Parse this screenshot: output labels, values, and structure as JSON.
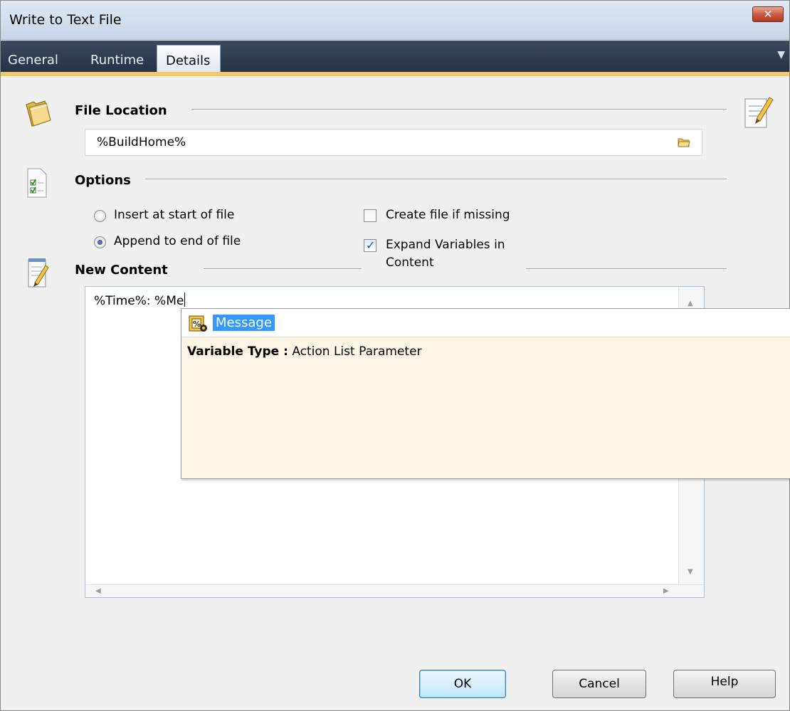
{
  "window": {
    "title": "Write to Text File"
  },
  "titlebar": {
    "close_glyph": "✕"
  },
  "tabs": [
    {
      "label": "General",
      "selected": false
    },
    {
      "label": "Runtime",
      "selected": false
    },
    {
      "label": "Details",
      "selected": true
    }
  ],
  "tab_menu_glyph": "▼",
  "file_location": {
    "title": "File Location",
    "value": "%BuildHome%",
    "icon": "folder-icon",
    "browse_icon": "folder-browse-icon"
  },
  "options": {
    "title": "Options",
    "icon": "checklist-icon",
    "insert_start_label": "Insert at start of file",
    "insert_start_checked": false,
    "append_end_label": "Append to end of file",
    "append_end_checked": true,
    "create_missing_label": "Create file if missing",
    "create_missing_checked": false,
    "expand_vars_label_line1": "Expand Variables in",
    "expand_vars_label_line2": "Content",
    "expand_vars_checked": true,
    "check_glyph": "✓"
  },
  "new_content": {
    "title": "New Content",
    "icon": "notepad-icon",
    "text": "%Time%: %Me",
    "scroll_up": "▲",
    "scroll_down": "▼",
    "scroll_left": "◀",
    "scroll_right": "▶"
  },
  "autocomplete": {
    "item_label": "Message",
    "item_icon": "variable-icon",
    "desc_key": "Variable Type :",
    "desc_value": "Action List Parameter",
    "bg_color": "#fdf5e6",
    "highlight_color": "#3399ff"
  },
  "buttons": {
    "ok": "OK",
    "cancel": "Cancel",
    "help": "Help"
  },
  "colors": {
    "tab_accent": "#f6c766",
    "tabbar": "#263244",
    "close_button": "#c9553d"
  }
}
